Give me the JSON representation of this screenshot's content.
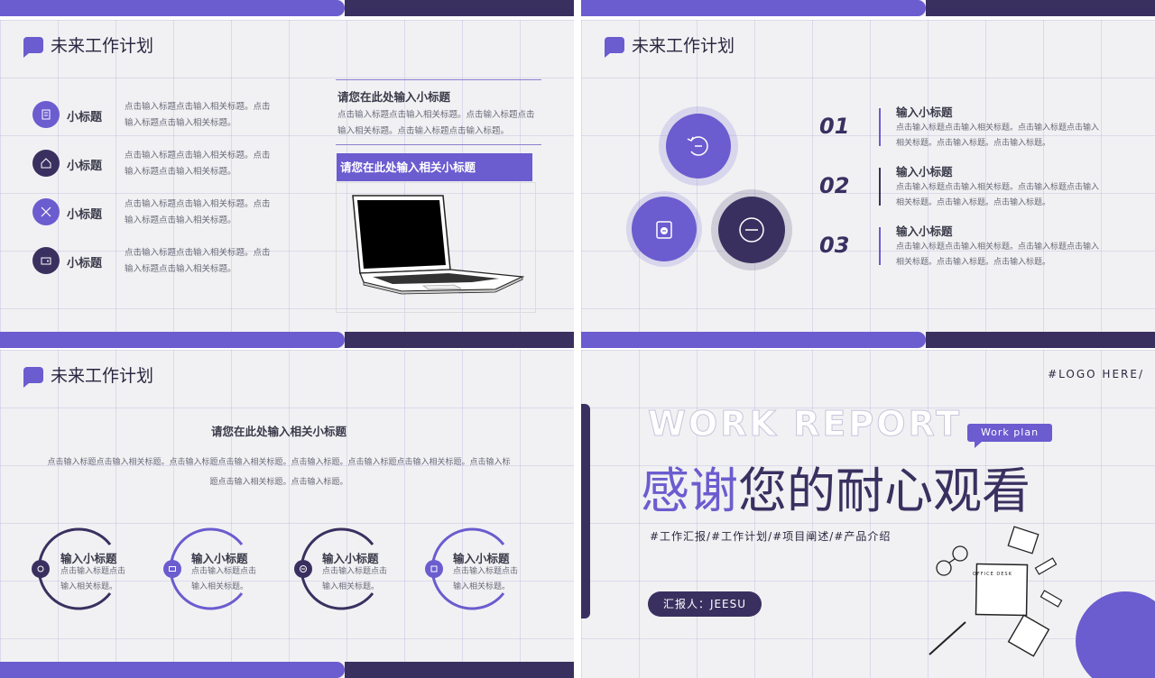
{
  "common": {
    "slide_title": "未来工作计划"
  },
  "slide1": {
    "items": [
      {
        "title": "小标题",
        "text1": "点击输入标题点击输入相关标题。点击",
        "text2": "输入标题点击输入相关标题。"
      },
      {
        "title": "小标题",
        "text1": "点击输入标题点击输入相关标题。点击",
        "text2": "输入标题点击输入相关标题。"
      },
      {
        "title": "小标题",
        "text1": "点击输入标题点击输入相关标题。点击",
        "text2": "输入标题点击输入相关标题。"
      },
      {
        "title": "小标题",
        "text1": "点击输入标题点击输入相关标题。点击",
        "text2": "输入标题点击输入相关标题。"
      }
    ],
    "right_heading": "请您在此处输入小标题",
    "right_text1": "点击输入标题点击输入相关标题。点击输入标题点击",
    "right_text2": "输入相关标题。点击输入标题点击输入标题。",
    "banner": "请您在此处输入相关小标题"
  },
  "slide3": {
    "items": [
      {
        "num": "01",
        "title": "输入小标题",
        "text1": "点击输入标题点击输入相关标题。点击输入标题点击输入",
        "text2": "相关标题。点击输入标题。点击输入标题。"
      },
      {
        "num": "02",
        "title": "输入小标题",
        "text1": "点击输入标题点击输入相关标题。点击输入标题点击输入",
        "text2": "相关标题。点击输入标题。点击输入标题。"
      },
      {
        "num": "03",
        "title": "输入小标题",
        "text1": "点击输入标题点击输入相关标题。点击输入标题点击输入",
        "text2": "相关标题。点击输入标题。点击输入标题。"
      }
    ]
  },
  "slide4": {
    "heading": "请您在此处输入相关小标题",
    "text1": "点击输入标题点击输入相关标题。点击输入标题点击输入相关标题。点击输入标题。点击输入标题点击输入相关标题。点击输入标",
    "text2": "题点击输入相关标题。点击输入标题。",
    "items": [
      {
        "title": "输入小标题",
        "text1": "点击输入标题点击",
        "text2": "输入相关标题。"
      },
      {
        "title": "输入小标题",
        "text1": "点击输入标题点击",
        "text2": "输入相关标题。"
      },
      {
        "title": "输入小标题",
        "text1": "点击输入标题点击",
        "text2": "输入相关标题。"
      },
      {
        "title": "输入小标题",
        "text1": "点击输入标题点击",
        "text2": "输入相关标题。"
      }
    ]
  },
  "slide5": {
    "logo": "#LOGO HERE/",
    "work_report": "WORK REPORT",
    "work_plan": "Work plan",
    "thanks_a": "感谢",
    "thanks_b": "您的耐心观看",
    "tags": "#工作汇报/#工作计划/#项目阐述/#产品介绍",
    "reporter": "汇报人：JEESU",
    "office_desk": "OFFICE DESK"
  },
  "colors": {
    "accent": "#6b5ccf",
    "dark": "#3a3060",
    "bg": "#f1f1f3"
  }
}
